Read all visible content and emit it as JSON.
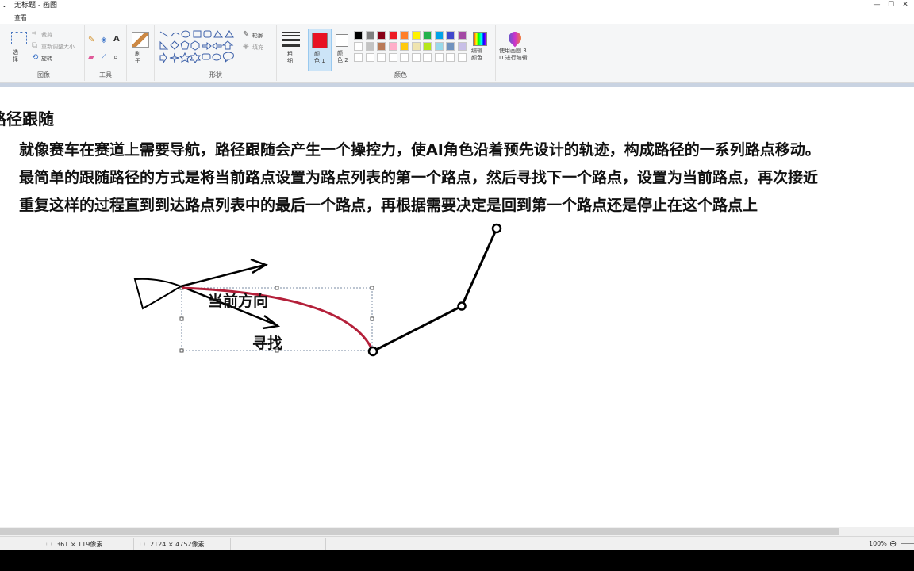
{
  "window": {
    "title": "无标题 - 画图",
    "quick_access": "⌄"
  },
  "tabs": {
    "view": "查看"
  },
  "ribbon": {
    "image": {
      "label": "图像",
      "select": "选\n择",
      "crop": "裁剪",
      "resize": "重新调整大小",
      "rotate": "旋转"
    },
    "tools": {
      "label": "工具"
    },
    "brush": {
      "label": "刷\n子"
    },
    "shapes": {
      "label": "形状",
      "outline": "轮廓",
      "fill": "填充"
    },
    "size": {
      "label": "粗\n细"
    },
    "colors": {
      "label": "颜色",
      "color1": "颜\n色 1",
      "color2": "颜\n色 2",
      "color1_value": "#e81123",
      "color2_value": "#ffffff",
      "palette": [
        "#000000",
        "#7f7f7f",
        "#880015",
        "#ed1c24",
        "#ff7f27",
        "#fff200",
        "#22b14c",
        "#00a2e8",
        "#3f48cc",
        "#a349a4",
        "#ffffff",
        "#c3c3c3",
        "#b97a57",
        "#ffaec9",
        "#ffc90e",
        "#efe4b0",
        "#b5e61d",
        "#99d9ea",
        "#7092be",
        "#c8bfe7",
        "#ffffff",
        "#ffffff",
        "#ffffff",
        "#ffffff",
        "#ffffff",
        "#ffffff",
        "#ffffff",
        "#ffffff",
        "#ffffff",
        "#ffffff"
      ],
      "edit": "编辑\n颜色"
    },
    "paint3d": {
      "label": "使用画图 3\nD 进行编辑"
    }
  },
  "document": {
    "heading": "路径跟随",
    "lines": [
      "就像赛车在赛道上需要导航，路径跟随会产生一个操控力，使AI角色沿着预先设计的轨迹，构成路径的一系列路点移动。",
      "最简单的跟随路径的方式是将当前路点设置为路点列表的第一个路点，然后寻找下一个路点，设置为当前路点，再次接近",
      "重复这样的过程直到到达路点列表中的最后一个路点，再根据需要决定是回到第一个路点还是停止在这个路点上"
    ],
    "drawing": {
      "label_current_direction": "当前方向",
      "label_seek": "寻找"
    }
  },
  "status": {
    "selection_size": "361 × 119像素",
    "image_size": "2124 × 4752像素",
    "zoom": "100%"
  }
}
